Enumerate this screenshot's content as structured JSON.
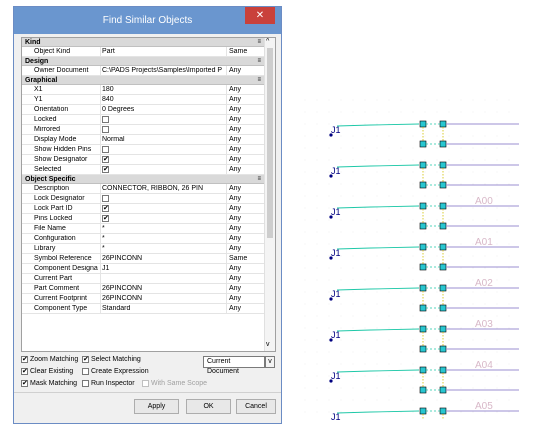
{
  "dialog": {
    "title": "Find Similar Objects",
    "close_glyph": "✕",
    "categories": {
      "kind": "Kind",
      "design": "Design",
      "graphical": "Graphical",
      "object_specific": "Object Specific"
    },
    "rows": [
      {
        "name": "Object Kind",
        "value": "Part",
        "match": "Same"
      },
      {
        "name": "Owner Document",
        "value": "C:\\PADS Projects\\Samples\\Imported PREV",
        "match": "Any"
      },
      {
        "name": "X1",
        "value": "180",
        "match": "Any"
      },
      {
        "name": "Y1",
        "value": "840",
        "match": "Any"
      },
      {
        "name": "Orientation",
        "value": "0 Degrees",
        "match": "Any"
      },
      {
        "name": "Locked",
        "value": "",
        "match": "Any",
        "checkbox": false
      },
      {
        "name": "Mirrored",
        "value": "",
        "match": "Any",
        "checkbox": false
      },
      {
        "name": "Display Mode",
        "value": "Normal",
        "match": "Any"
      },
      {
        "name": "Show Hidden Pins",
        "value": "",
        "match": "Any",
        "checkbox": false
      },
      {
        "name": "Show Designator",
        "value": "",
        "match": "Any",
        "checkbox": true
      },
      {
        "name": "Selected",
        "value": "",
        "match": "Any",
        "checkbox": true
      },
      {
        "name": "Description",
        "value": "CONNECTOR, RIBBON, 26 PIN",
        "match": "Any"
      },
      {
        "name": "Lock Designator",
        "value": "",
        "match": "Any",
        "checkbox": false
      },
      {
        "name": "Lock Part ID",
        "value": "",
        "match": "Any",
        "checkbox": true
      },
      {
        "name": "Pins Locked",
        "value": "",
        "match": "Any",
        "checkbox": true
      },
      {
        "name": "File Name",
        "value": "*",
        "match": "Any"
      },
      {
        "name": "Configuration",
        "value": "*",
        "match": "Any"
      },
      {
        "name": "Library",
        "value": "*",
        "match": "Any"
      },
      {
        "name": "Symbol Reference",
        "value": "26PINCONN",
        "match": "Same"
      },
      {
        "name": "Component Designato",
        "value": "J1",
        "match": "Any"
      },
      {
        "name": "Current Part",
        "value": "",
        "match": "Any"
      },
      {
        "name": "Part Comment",
        "value": "26PINCONN",
        "match": "Any"
      },
      {
        "name": "Current Footprint",
        "value": "26PINCONN",
        "match": "Any"
      },
      {
        "name": "Component Type",
        "value": "Standard",
        "match": "Any"
      }
    ],
    "options": {
      "zoom_matching": {
        "label": "Zoom Matching",
        "checked": true
      },
      "select_matching": {
        "label": "Select Matching",
        "checked": true
      },
      "clear_existing": {
        "label": "Clear Existing",
        "checked": true
      },
      "create_expression": {
        "label": "Create Expression",
        "checked": false
      },
      "mask_matching": {
        "label": "Mask Matching",
        "checked": true
      },
      "run_inspector": {
        "label": "Run Inspector",
        "checked": false
      },
      "with_same_scope": {
        "label": "With Same Scope",
        "checked": false
      }
    },
    "scope_dropdown": {
      "value": "Current Document"
    },
    "buttons": {
      "apply": "Apply",
      "ok": "OK",
      "cancel": "Cancel"
    }
  },
  "schematic": {
    "designator": "J1",
    "net_labels": [
      "A00",
      "A01",
      "A02",
      "A03",
      "A04",
      "A05"
    ],
    "colors": {
      "wire": "#1fc8a8",
      "bus": "#9b8fd0",
      "net_label": "#d8b8c8",
      "pin_box": "#28c6d0",
      "designator": "#000080"
    }
  }
}
